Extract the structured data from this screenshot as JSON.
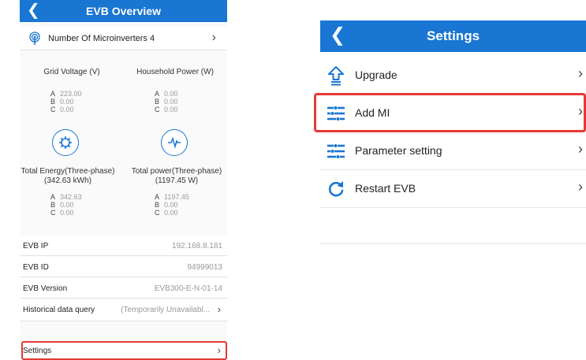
{
  "overview": {
    "title": "EVB Overview",
    "back_glyph": "❮",
    "microinverters_label": "Number Of Microinverters 4",
    "chevron": "›",
    "grid_voltage_title": "Grid Voltage  (V)",
    "household_power_title": "Household Power  (W)",
    "grid_voltage": [
      {
        "phase": "A",
        "value": "223.00"
      },
      {
        "phase": "B",
        "value": "0.00"
      },
      {
        "phase": "C",
        "value": "0.00"
      }
    ],
    "household_power": [
      {
        "phase": "A",
        "value": "0.00"
      },
      {
        "phase": "B",
        "value": "0.00"
      },
      {
        "phase": "C",
        "value": "0.00"
      }
    ],
    "total_energy_title": "Total Energy(Three-phase)",
    "total_energy_value": "(342.63 kWh)",
    "total_power_title": "Total power(Three-phase)",
    "total_power_value": "(1197.45 W)",
    "total_energy": [
      {
        "phase": "A",
        "value": "342.63"
      },
      {
        "phase": "B",
        "value": "0.00"
      },
      {
        "phase": "C",
        "value": "0.00"
      }
    ],
    "total_power": [
      {
        "phase": "A",
        "value": "1197.45"
      },
      {
        "phase": "B",
        "value": "0.00"
      },
      {
        "phase": "C",
        "value": "0.00"
      }
    ],
    "info": {
      "ip_label": "EVB IP",
      "ip_value": "192.168.8.181",
      "id_label": "EVB ID",
      "id_value": "94999013",
      "version_label": "EVB Version",
      "version_value": "EVB300-E-N-01-14",
      "history_label": "Historical data query",
      "history_value": "(Temporarily Unavailabl...",
      "settings_label": "Settings"
    }
  },
  "settings": {
    "title": "Settings",
    "back_glyph": "❮",
    "chevron": "›",
    "items": [
      {
        "label": "Upgrade",
        "icon": "upgrade-icon"
      },
      {
        "label": "Add MI",
        "icon": "sliders-icon"
      },
      {
        "label": "Parameter setting",
        "icon": "sliders-icon"
      },
      {
        "label": "Restart EVB",
        "icon": "restart-icon"
      }
    ]
  },
  "colors": {
    "header_blue": "#1976d2",
    "highlight_red": "#e53935"
  }
}
